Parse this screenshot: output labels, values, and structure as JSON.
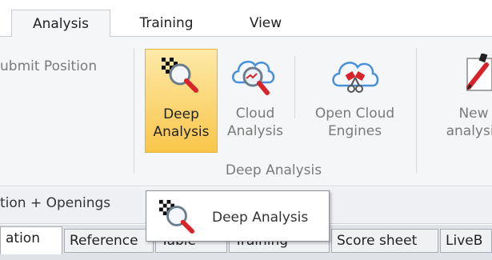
{
  "ribbon_tabs": [
    "Analysis",
    "Training",
    "View"
  ],
  "ribbon": {
    "submit_position_label": "ubmit Position",
    "deep_analysis": {
      "line1": "Deep",
      "line2": "Analysis"
    },
    "cloud_analysis": {
      "line1": "Cloud",
      "line2": "Analysis"
    },
    "open_cloud_engines": {
      "line1": "Open Cloud",
      "line2": "Engines"
    },
    "new_analysis": {
      "line1": "New",
      "line2": "analysis"
    },
    "group_label": "Deep Analysis"
  },
  "pane": {
    "title": "tion + Openings"
  },
  "pane_tabs": [
    "ation",
    "Reference",
    "Table",
    "Training",
    "Score sheet",
    "LiveB"
  ],
  "tooltip": {
    "text": "Deep Analysis"
  },
  "icons": {
    "deep_analysis": "chess-magnifier-icon",
    "cloud_analysis": "cloud-magnifier-icon",
    "open_cloud_engines": "cloud-engines-icon",
    "new_analysis": "new-analysis-icon"
  },
  "colors": {
    "hover_button": "#f9c64a",
    "accent_red": "#d9232a"
  }
}
